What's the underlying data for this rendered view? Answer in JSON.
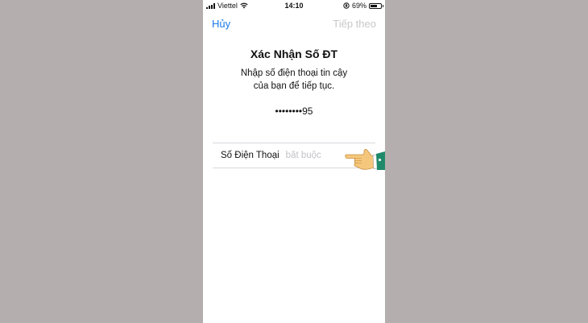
{
  "status_bar": {
    "carrier": "Viettel",
    "time": "14:10",
    "battery_percent": "69%",
    "battery_level": 0.69
  },
  "nav": {
    "cancel_label": "Hủy",
    "next_label": "Tiếp theo"
  },
  "content": {
    "title": "Xác Nhận Số ĐT",
    "subtitle_line1": "Nhập số điện thoại tin cậy",
    "subtitle_line2": "của bạn để tiếp tục.",
    "masked_number": "••••••••95"
  },
  "phone_field": {
    "label": "Số Điện Thoại",
    "placeholder": "bắt buộc",
    "value": ""
  },
  "colors": {
    "background": "#b4afae",
    "accent": "#1a7ae8",
    "disabled": "#c8c8cc",
    "hand_cuff": "#1f8a6a"
  },
  "icons": {
    "signal": "signal-bars-icon",
    "wifi": "wifi-icon",
    "orientation_lock": "orientation-lock-icon",
    "battery": "battery-icon",
    "pointer": "pointing-hand-icon"
  }
}
